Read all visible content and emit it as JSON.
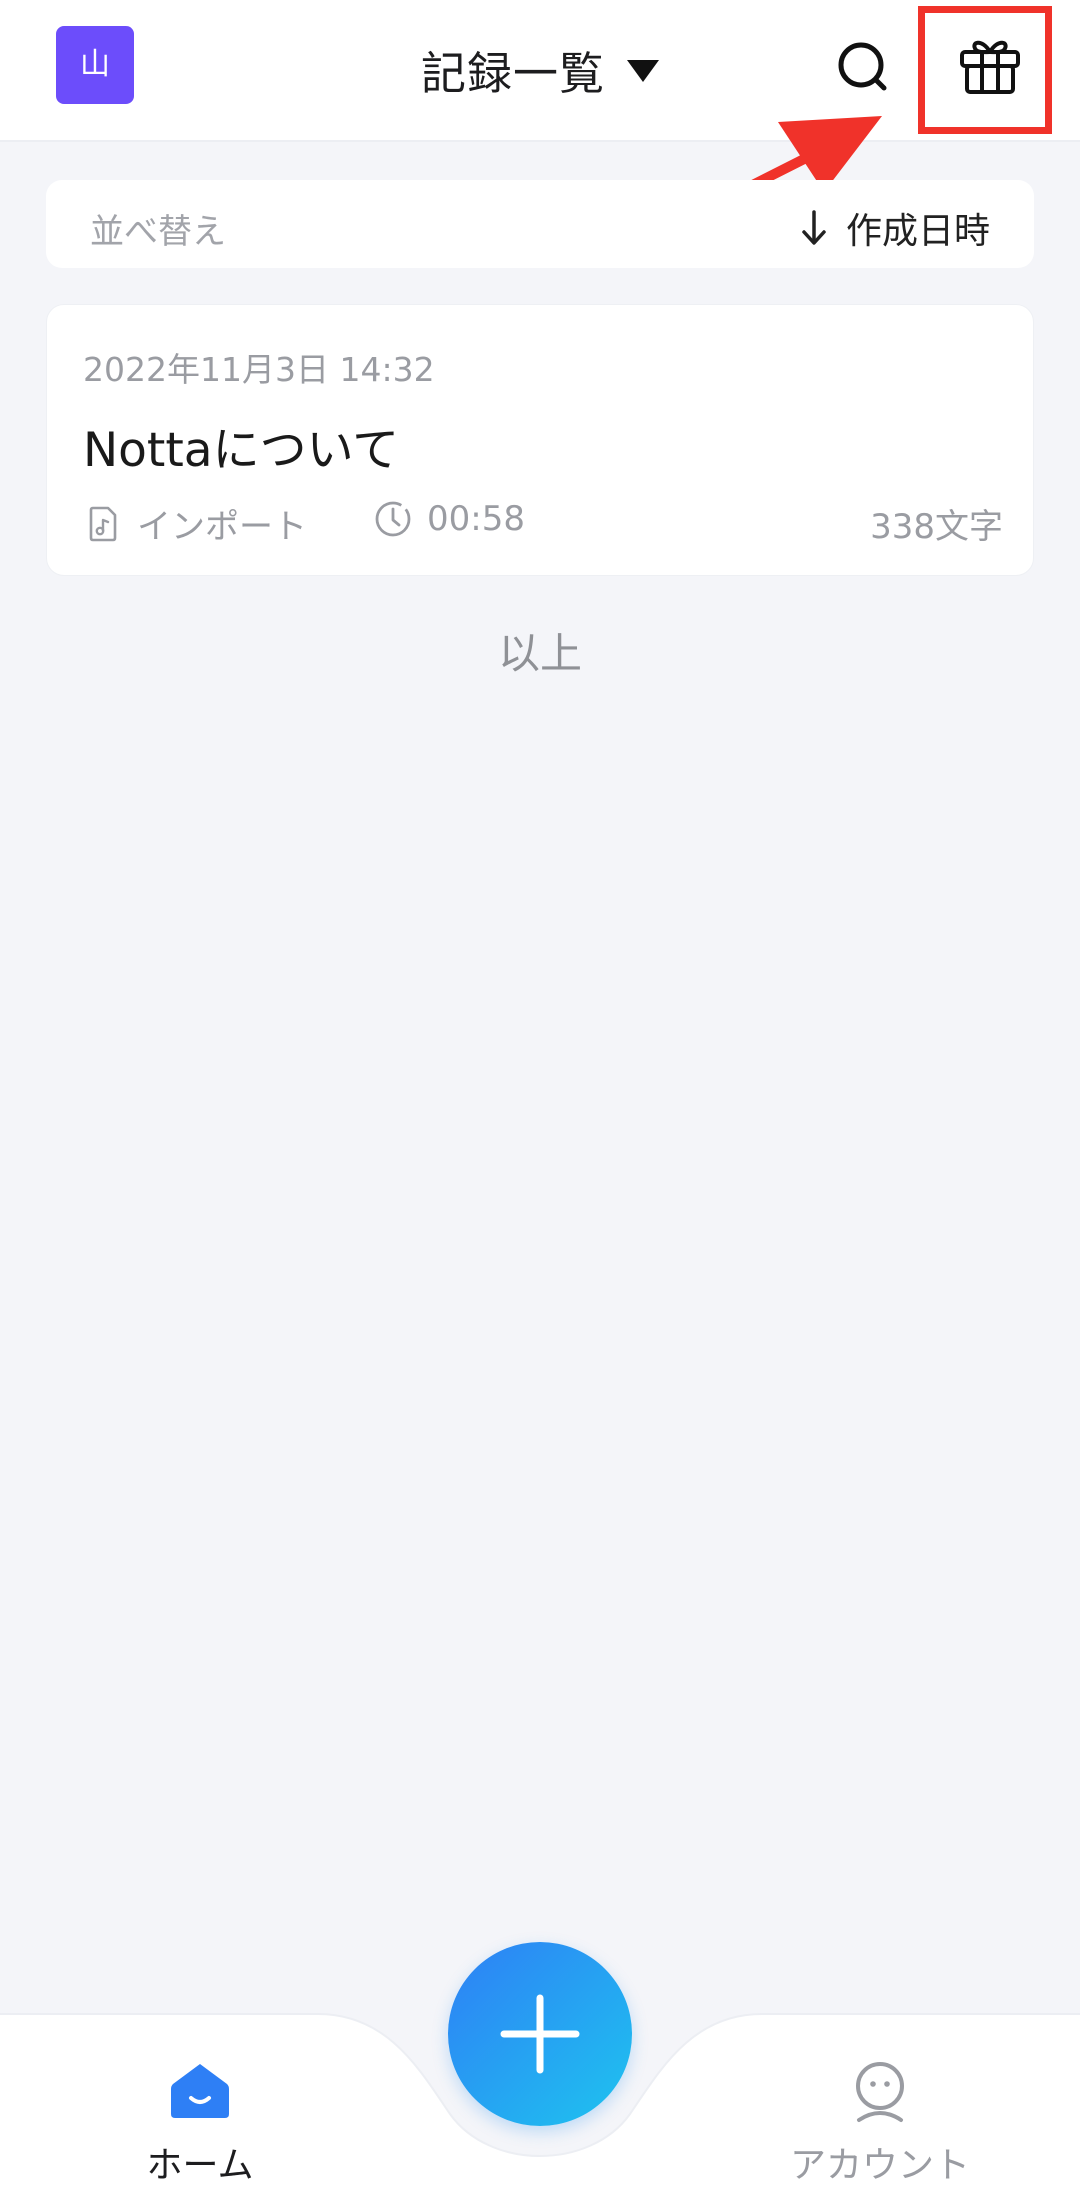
{
  "header": {
    "avatar_text": "山",
    "title": "記録一覧",
    "dropdown_icon": "caret-down-icon",
    "search_icon": "search-icon",
    "gift_icon": "gift-icon",
    "highlight_color": "#f0322a"
  },
  "sort": {
    "label": "並べ替え",
    "value": "作成日時",
    "direction_icon": "arrow-down-icon"
  },
  "records": [
    {
      "date": "2022年11月3日  14:32",
      "title": "Nottaについて",
      "source": "インポート",
      "duration": "00:58",
      "chars": "338文字"
    }
  ],
  "list_end_label": "以上",
  "bottom_nav": {
    "home_label": "ホーム",
    "account_label": "アカウント",
    "fab_icon": "plus-icon"
  },
  "colors": {
    "accent": "#2e7ff5",
    "avatar_bg": "#6c4dfb",
    "background": "#f4f5f9"
  }
}
